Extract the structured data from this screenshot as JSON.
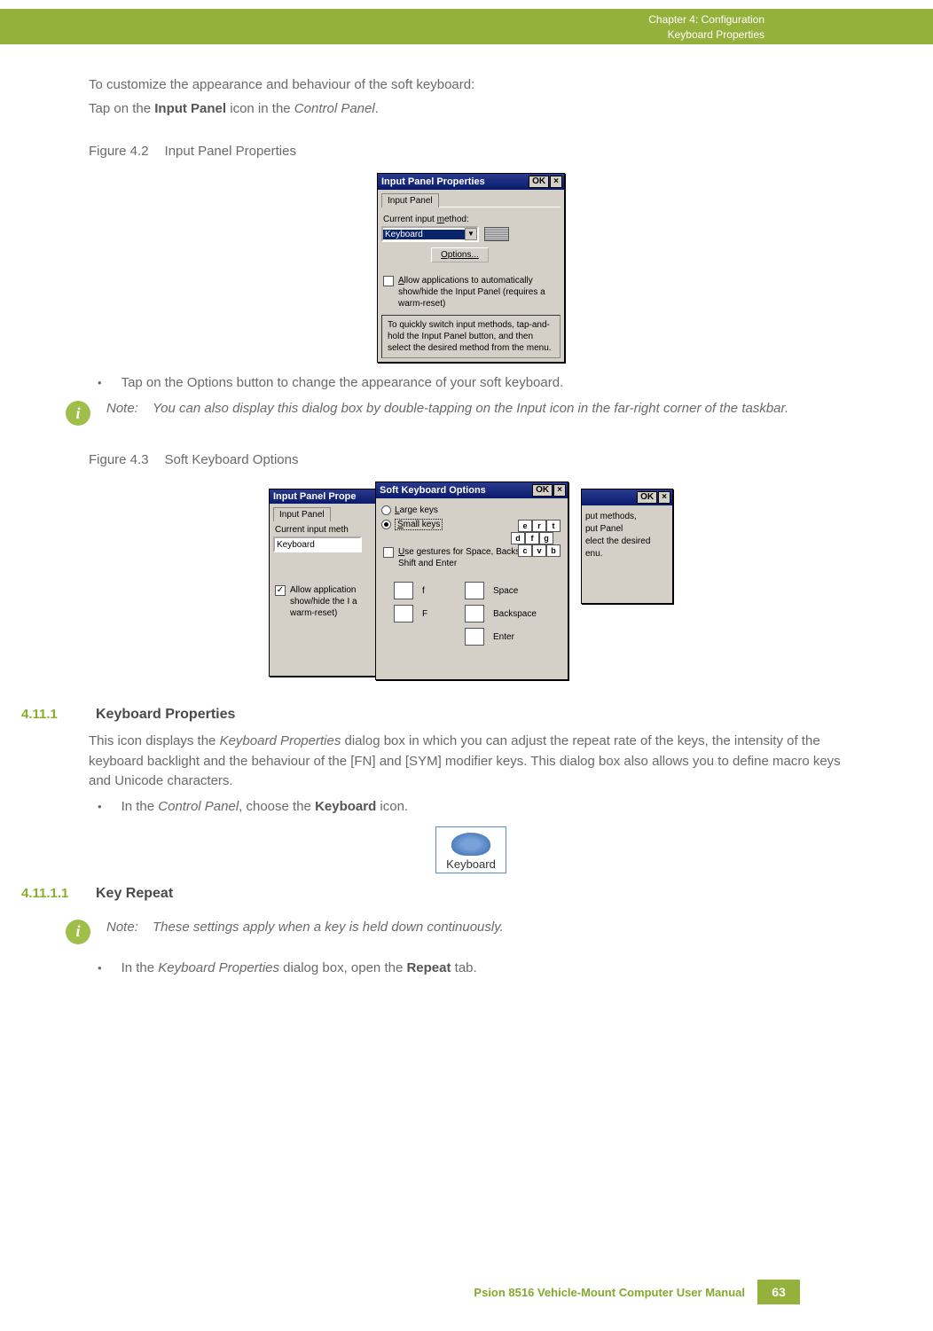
{
  "header": {
    "chapter": "Chapter 4:  Configuration",
    "section": "Keyboard Properties"
  },
  "intro": {
    "line1": "To customize the appearance and behaviour of the soft keyboard:",
    "line2_pre": "Tap on the ",
    "line2_bold": "Input Panel",
    "line2_mid": " icon in the ",
    "line2_italic": "Control Panel",
    "line2_post": "."
  },
  "fig42": {
    "num": "Figure 4.2",
    "title": "Input Panel Properties"
  },
  "dialog1": {
    "title": "Input Panel Properties",
    "ok": "OK",
    "close": "×",
    "tab": "Input Panel",
    "label_method": "Current input method:",
    "combo_value": "Keyboard",
    "options_btn": "Options...",
    "check_label": "Allow applications to automatically show/hide the Input Panel (requires a warm-reset)",
    "tip": "To quickly switch input methods, tap-and-hold the Input Panel button, and then select the desired method from the menu."
  },
  "bullet1": "Tap on the Options button to change the appearance of your soft keyboard.",
  "note1": {
    "label": "Note:",
    "text": "You can also display this dialog box by double-tapping on the Input icon in the far-right corner of the taskbar."
  },
  "fig43": {
    "num": "Figure 4.3",
    "title": "Soft Keyboard Options"
  },
  "dialog2": {
    "back_left_title": "Input Panel Prope",
    "back_left_tab": "Input Panel",
    "back_left_label": "Current input meth",
    "back_left_combo": "Keyboard",
    "back_left_check": "Allow application show/hide the I a warm-reset)",
    "front_title": "Soft Keyboard Options",
    "ok": "OK",
    "close": "×",
    "radio_large": "Large keys",
    "radio_small": "Small keys",
    "keys_r1": [
      "e",
      "r",
      "t"
    ],
    "keys_r2": [
      "d",
      "f",
      "g"
    ],
    "keys_r3": [
      "c",
      "v",
      "b"
    ],
    "gesture_check": "Use gestures for Space, Backspace, Shift and Enter",
    "g_f": "f",
    "g_F": "F",
    "g_space": "Space",
    "g_back": "Backspace",
    "g_enter": "Enter",
    "back_right_text": "put methods,\nput Panel\nelect the desired\nenu."
  },
  "sec4111": {
    "num": "4.11.1",
    "title": "Keyboard Properties",
    "body_pre": "This icon displays the ",
    "body_i1": "Keyboard Properties",
    "body_mid": " dialog box in which you can adjust the repeat rate of the keys, the intensity of the keyboard backlight and the behaviour of the [FN] and [SYM] modifier keys. This dialog box also allows you to define macro keys and Unicode characters.",
    "bullet_pre": "In the ",
    "bullet_i": "Control Panel",
    "bullet_mid": ", choose the ",
    "bullet_b": "Keyboard",
    "bullet_post": " icon.",
    "icon_label": "Keyboard"
  },
  "sec41111": {
    "num": "4.11.1.1",
    "title": "Key Repeat"
  },
  "note2": {
    "label": "Note:",
    "text": "These settings apply when a key is held down continuously."
  },
  "bullet2": {
    "pre": "In the ",
    "i": "Keyboard Properties",
    "mid": " dialog box, open the ",
    "b": "Repeat",
    "post": " tab."
  },
  "footer": {
    "manual": "Psion 8516 Vehicle-Mount Computer User Manual",
    "page": "63"
  }
}
